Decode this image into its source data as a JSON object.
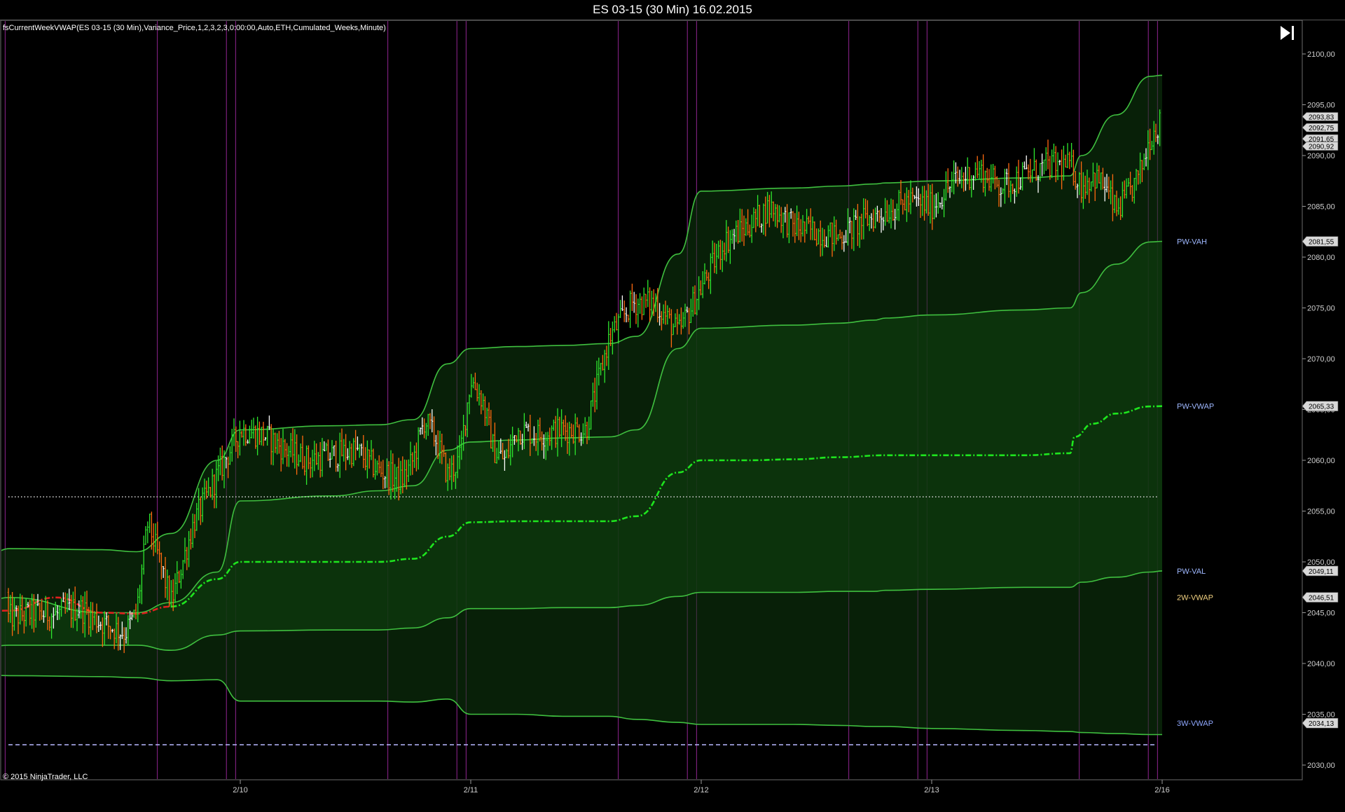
{
  "window_title": "ES 03-15 (30 Min)  16.02.2015",
  "indicator_label": "fsCurrentWeekVWAP(ES 03-15 (30 Min),Variance_Price,1,2,3,2,3,0:00:00,Auto,ETH,Cumulated_Weeks,Minute)",
  "copyright": "© 2015 NinjaTrader, LLC",
  "icons": {
    "jump_end": "skip-to-end-icon"
  },
  "colors": {
    "background": "#000000",
    "band_fill": "#0e3a0e",
    "band_line": "#3fbf3f",
    "vwap_current": "#1ee61e",
    "vwap_initial": "#e02020",
    "candle_up": "#2ee62e",
    "candle_down": "#ff6a10",
    "doji": "#ffffff",
    "session_separator": "#7a1f7a",
    "dotted_level": "#c8c8c8",
    "dashed_level": "#b8b8ff",
    "label_pw": "#9fb8ff",
    "label_2w": "#f0d080",
    "label_3w": "#8fa8ff"
  },
  "chart_data": {
    "type": "line",
    "title": "ES 03-15 (30 Min)  16.02.2015",
    "xlabel": "",
    "ylabel": "",
    "x_tick_labels": [
      "2/10",
      "2/11",
      "2/12",
      "2/13",
      "2/16"
    ],
    "x_tick_positions_days": [
      1.0,
      2.0,
      3.0,
      4.0,
      5.0
    ],
    "x_range_days": [
      0.0,
      5.55
    ],
    "y_tick_labels": [
      "2030,00",
      "2035,00",
      "2040,00",
      "2045,00",
      "2050,00",
      "2055,00",
      "2060,00",
      "2065,00",
      "2070,00",
      "2075,00",
      "2080,00",
      "2085,00",
      "2090,00",
      "2095,00",
      "2100,00"
    ],
    "ylim": [
      2028.5,
      2103.0
    ],
    "grid": false,
    "right_labels": [
      {
        "text": "PW-VAH",
        "value": 2081.55,
        "price": "2081,55"
      },
      {
        "text": "PW-VWAP",
        "value": 2065.33,
        "price": "2065,33"
      },
      {
        "text": "PW-VAL",
        "value": 2049.11,
        "price": "2049,11"
      },
      {
        "text": "2W-VWAP",
        "value": 2046.51,
        "price": "2046,51"
      },
      {
        "text": "3W-VWAP",
        "value": 2034.13,
        "price": "2034,13"
      }
    ],
    "price_markers": [
      "2093,83",
      "2092,75",
      "2091,65",
      "2090,92"
    ],
    "price_marker_values": [
      2093.83,
      2092.75,
      2091.65,
      2090.92
    ],
    "horizontal_levels": [
      {
        "value": 2056.4,
        "style": "dotted"
      },
      {
        "value": 2032.0,
        "style": "dashed"
      }
    ],
    "session_separators_days": [
      -0.36,
      -0.06,
      -0.02,
      0.64,
      0.94,
      0.98,
      1.64,
      1.94,
      1.98,
      2.64,
      2.94,
      2.98,
      3.64,
      3.94,
      3.98,
      4.64,
      4.94,
      4.98
    ],
    "series": [
      {
        "name": "VWAP",
        "style": "dash-dot",
        "x": [
          -1.0,
          -0.8,
          -0.6,
          -0.4,
          -0.2,
          0.0,
          0.2,
          0.4,
          0.55,
          0.7,
          0.9,
          1.0,
          1.2,
          1.4,
          1.6,
          1.75,
          1.9,
          2.0,
          2.2,
          2.4,
          2.6,
          2.72,
          2.9,
          3.0,
          3.2,
          3.4,
          3.6,
          3.8,
          4.0,
          4.2,
          4.4,
          4.6,
          4.62,
          4.7,
          4.8,
          4.95,
          5.0
        ],
        "y": [
          2046.3,
          2045.8,
          2045.0,
          2044.9,
          2045.1,
          2045.2,
          2046.5,
          2045.0,
          2044.9,
          2045.6,
          2048.3,
          2050.0,
          2050.0,
          2050.0,
          2050.0,
          2050.3,
          2052.5,
          2053.9,
          2054.0,
          2054.0,
          2054.0,
          2054.5,
          2058.8,
          2060.0,
          2060.0,
          2060.1,
          2060.3,
          2060.5,
          2060.5,
          2060.5,
          2060.5,
          2060.7,
          2062.3,
          2063.6,
          2064.6,
          2065.3,
          2065.33
        ]
      },
      {
        "name": "Band +1",
        "style": "solid",
        "x": [
          -1.0,
          -0.6,
          -0.4,
          -0.2,
          0.0,
          0.4,
          0.55,
          0.7,
          0.9,
          1.0,
          1.4,
          1.6,
          1.75,
          1.9,
          2.0,
          2.2,
          2.4,
          2.6,
          2.72,
          2.9,
          3.0,
          3.4,
          3.6,
          3.75,
          3.8,
          4.0,
          4.4,
          4.6,
          4.65,
          4.8,
          4.95,
          5.0
        ],
        "y": [
          2049.0,
          2048.2,
          2047.5,
          2045.0,
          2046.5,
          2045.0,
          2045.0,
          2046.0,
          2049.0,
          2056.0,
          2056.5,
          2057.0,
          2057.5,
          2061.0,
          2061.8,
          2062.0,
          2062.2,
          2062.3,
          2063.0,
          2071.0,
          2073.0,
          2073.3,
          2073.5,
          2073.8,
          2074.0,
          2074.3,
          2074.8,
          2075.0,
          2076.5,
          2079.3,
          2081.5,
          2081.55
        ]
      },
      {
        "name": "Band +2",
        "style": "solid",
        "x": [
          -1.0,
          -0.6,
          -0.4,
          -0.2,
          0.0,
          0.4,
          0.55,
          0.7,
          0.9,
          1.0,
          1.4,
          1.6,
          1.75,
          1.9,
          2.0,
          2.2,
          2.4,
          2.6,
          2.72,
          2.9,
          3.0,
          3.4,
          3.6,
          3.75,
          3.8,
          4.0,
          4.4,
          4.6,
          4.65,
          4.8,
          4.95,
          5.0
        ],
        "y": [
          2050.3,
          2049.7,
          2049.0,
          2048.0,
          2051.3,
          2051.2,
          2051.0,
          2052.8,
          2060.0,
          2063.0,
          2063.4,
          2063.5,
          2064.0,
          2069.5,
          2071.0,
          2071.2,
          2071.3,
          2071.5,
          2072.2,
          2080.3,
          2086.5,
          2086.8,
          2087.0,
          2087.2,
          2087.3,
          2087.5,
          2087.8,
          2088.0,
          2090.0,
          2094.0,
          2097.8,
          2097.9
        ]
      },
      {
        "name": "Band -1",
        "style": "solid",
        "x": [
          -1.0,
          -0.6,
          -0.4,
          -0.2,
          0.0,
          0.4,
          0.55,
          0.7,
          0.9,
          1.0,
          1.4,
          1.6,
          1.75,
          1.9,
          2.0,
          2.2,
          2.4,
          2.6,
          2.72,
          2.9,
          3.0,
          3.4,
          3.6,
          3.75,
          3.8,
          4.0,
          4.4,
          4.6,
          4.65,
          4.8,
          4.95,
          5.0
        ],
        "y": [
          2043.5,
          2042.8,
          2042.0,
          2041.0,
          2041.8,
          2041.8,
          2041.8,
          2041.3,
          2042.8,
          2043.2,
          2043.3,
          2043.3,
          2043.5,
          2044.5,
          2045.4,
          2045.4,
          2045.5,
          2045.5,
          2045.7,
          2046.6,
          2047.0,
          2047.0,
          2047.1,
          2047.1,
          2047.2,
          2047.3,
          2047.5,
          2047.5,
          2048.0,
          2048.5,
          2049.0,
          2049.11
        ]
      },
      {
        "name": "Band -2",
        "style": "solid",
        "x": [
          -1.0,
          -0.6,
          -0.4,
          -0.2,
          0.0,
          0.4,
          0.55,
          0.7,
          0.9,
          1.0,
          1.4,
          1.6,
          1.75,
          1.9,
          2.0,
          2.2,
          2.4,
          2.6,
          2.72,
          2.9,
          3.0,
          3.4,
          3.6,
          3.75,
          3.8,
          4.0,
          4.4,
          4.6,
          4.65,
          4.8,
          4.95,
          5.0
        ],
        "y": [
          2041.5,
          2040.8,
          2040.0,
          2039.0,
          2038.8,
          2038.7,
          2038.6,
          2038.3,
          2038.4,
          2036.3,
          2036.3,
          2036.3,
          2036.2,
          2036.5,
          2035.0,
          2035.0,
          2034.8,
          2034.8,
          2034.5,
          2034.2,
          2034.0,
          2034.0,
          2033.9,
          2033.8,
          2033.8,
          2033.6,
          2033.4,
          2033.3,
          2033.2,
          2033.1,
          2033.0,
          2033.0
        ]
      }
    ],
    "price_path": {
      "x": [
        -1.0,
        -0.9,
        -0.7,
        -0.5,
        -0.4,
        -0.3,
        -0.2,
        -0.1,
        0.0,
        0.1,
        0.2,
        0.3,
        0.4,
        0.5,
        0.55,
        0.6,
        0.7,
        0.8,
        0.9,
        1.0,
        1.1,
        1.2,
        1.3,
        1.4,
        1.5,
        1.6,
        1.7,
        1.75,
        1.8,
        1.85,
        1.9,
        1.95,
        2.0,
        2.05,
        2.1,
        2.15,
        2.2,
        2.3,
        2.4,
        2.5,
        2.6,
        2.7,
        2.8,
        2.9,
        3.0,
        3.1,
        3.2,
        3.3,
        3.4,
        3.5,
        3.6,
        3.7,
        3.8,
        3.9,
        4.0,
        4.1,
        4.2,
        4.3,
        4.4,
        4.5,
        4.6,
        4.65,
        4.7,
        4.75,
        4.8,
        4.85,
        4.9,
        4.95,
        5.0
      ],
      "y": [
        2047.0,
        2044.0,
        2045.0,
        2041.5,
        2048.0,
        2046.0,
        2040.0,
        2045.0,
        2044.5,
        2045.0,
        2044.8,
        2045.5,
        2044.0,
        2043.0,
        2045.0,
        2054.0,
        2046.0,
        2054.0,
        2058.5,
        2063.0,
        2062.5,
        2061.0,
        2060.0,
        2060.5,
        2061.0,
        2059.0,
        2058.0,
        2060.0,
        2064.0,
        2062.0,
        2058.5,
        2060.0,
        2068.0,
        2066.0,
        2061.0,
        2060.0,
        2063.0,
        2062.5,
        2063.0,
        2063.0,
        2072.0,
        2075.5,
        2075.5,
        2072.5,
        2077.0,
        2081.5,
        2083.0,
        2085.0,
        2083.0,
        2082.5,
        2082.0,
        2083.5,
        2084.5,
        2085.5,
        2085.0,
        2087.5,
        2088.5,
        2087.0,
        2088.0,
        2089.0,
        2089.0,
        2087.0,
        2088.0,
        2087.0,
        2084.5,
        2086.0,
        2088.0,
        2092.0,
        2093.5
      ]
    }
  }
}
